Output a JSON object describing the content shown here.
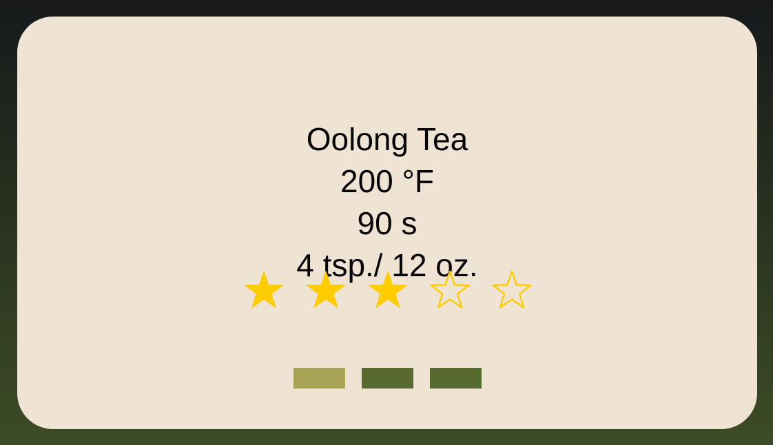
{
  "tea": {
    "name": "Oolong Tea",
    "temperature": "200 °F",
    "steep_time": "90 s",
    "amount": "4 tsp./ 12 oz."
  },
  "rating": {
    "value": 3,
    "max": 5,
    "filled_icon": "star-filled-icon",
    "empty_icon": "star-outline-icon",
    "color": "#ffcc00"
  },
  "page_indicator": {
    "count": 3,
    "selected_index": 0,
    "selected_color": "#a9a354",
    "unselected_color": "#576b30"
  },
  "colors": {
    "card_background": "#efe3d4",
    "text": "#050505"
  }
}
